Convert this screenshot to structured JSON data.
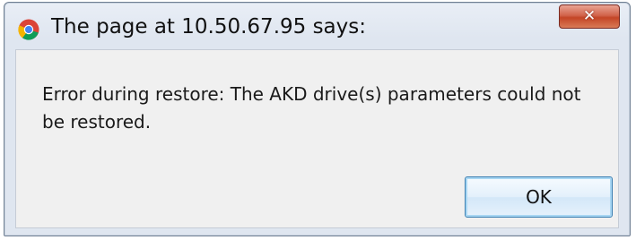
{
  "dialog": {
    "title": "The page at 10.50.67.95 says:",
    "title_icon": "chrome-logo-icon",
    "close_icon": "close-icon",
    "close_symbol": "✕",
    "message": "Error during restore: The AKD drive(s) parameters could not be restored.",
    "ok_label": "OK"
  },
  "colors": {
    "close_button": "#c9533a",
    "ok_border": "#3c7fb1",
    "content_bg": "#f0f0f0"
  }
}
